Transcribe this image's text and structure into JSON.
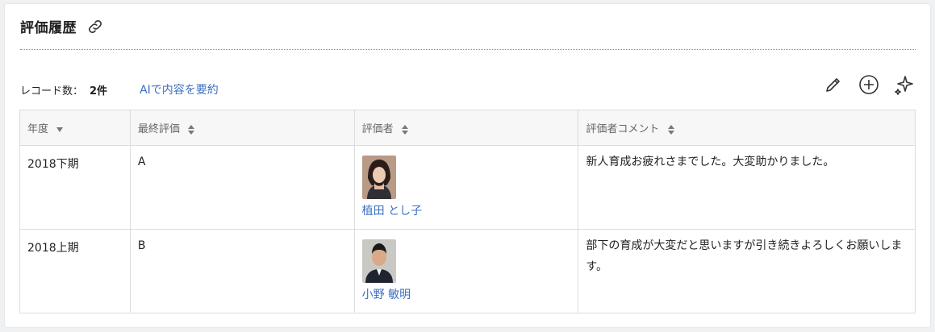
{
  "section": {
    "title": "評価履歴",
    "link_icon": "link-icon"
  },
  "meta": {
    "count_label": "レコード数：",
    "count_value": "2件",
    "ai_summary": "AIで内容を要約"
  },
  "tools": [
    {
      "icon": "pencil-icon"
    },
    {
      "icon": "plus-circle-icon"
    },
    {
      "icon": "sparkle-icon"
    }
  ],
  "table": {
    "headers": [
      "年度",
      "最終評価",
      "評価者",
      "評価者コメント"
    ],
    "rows": [
      {
        "period": "2018下期",
        "grade": "A",
        "evaluator": "植田 とし子",
        "comment": "新人育成お疲れさまでした。大変助かりました。"
      },
      {
        "period": "2018上期",
        "grade": "B",
        "evaluator": "小野 敏明",
        "comment": "部下の育成が大変だと思いますが引き続きよろしくお願いします。"
      }
    ]
  },
  "colors": {
    "link": "#3b6fc2",
    "header_bg": "#f7f7f8",
    "border": "#dcdcdc"
  }
}
